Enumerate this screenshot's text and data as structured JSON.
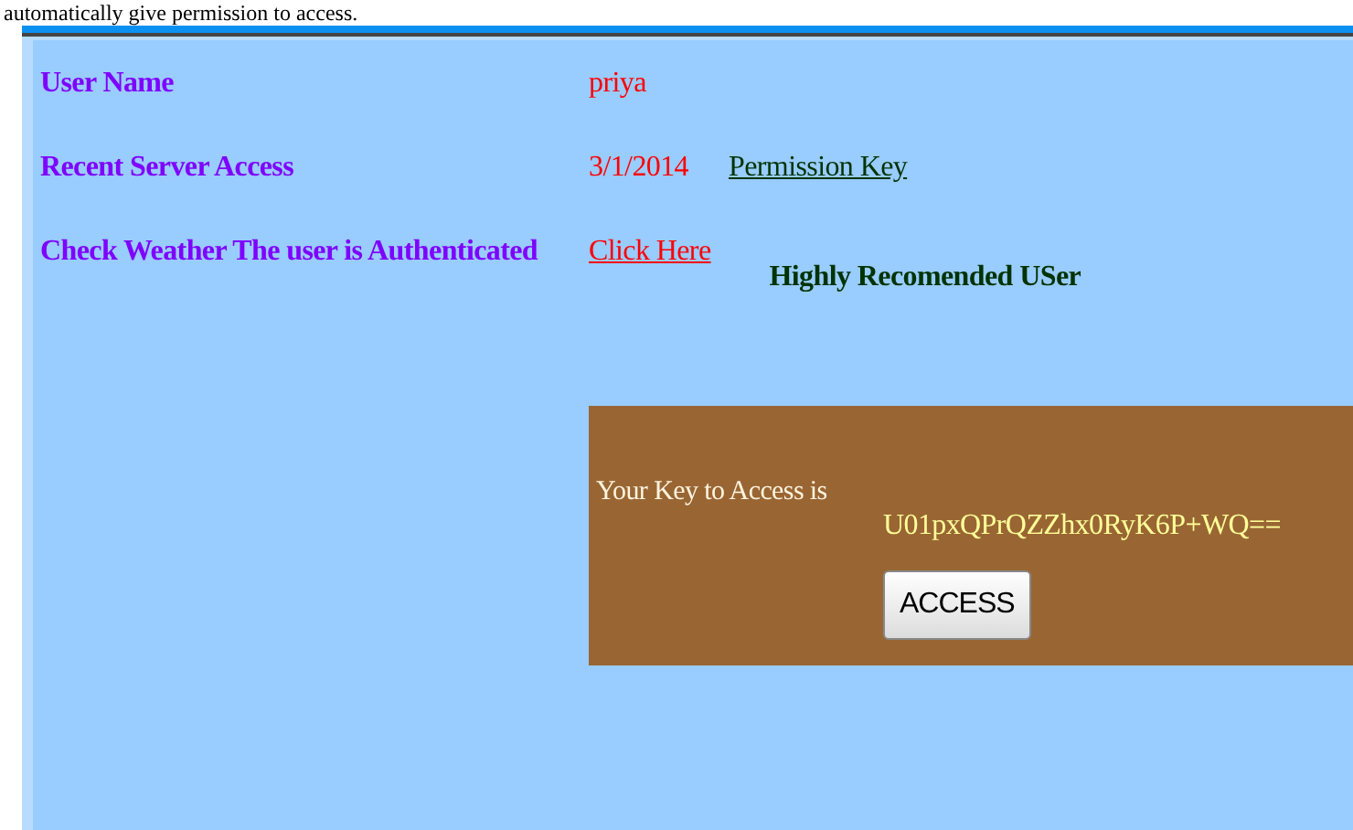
{
  "intro_text": "automatically give permission to access.",
  "fields": [
    {
      "label": "User Name",
      "value": "priya",
      "kind": "text"
    },
    {
      "label": "Recent Server Access",
      "value": "3/1/2014",
      "kind": "text",
      "link": "Permission Key"
    },
    {
      "label": "Check Weather The user is Authenticated",
      "value": "Click Here",
      "kind": "link",
      "note": "Highly Recomended USer"
    }
  ],
  "key_panel": {
    "label": "Your Key to Access is",
    "key": "U01pxQPrQZZhx0RyK6P+WQ==",
    "button": "ACCESS"
  }
}
